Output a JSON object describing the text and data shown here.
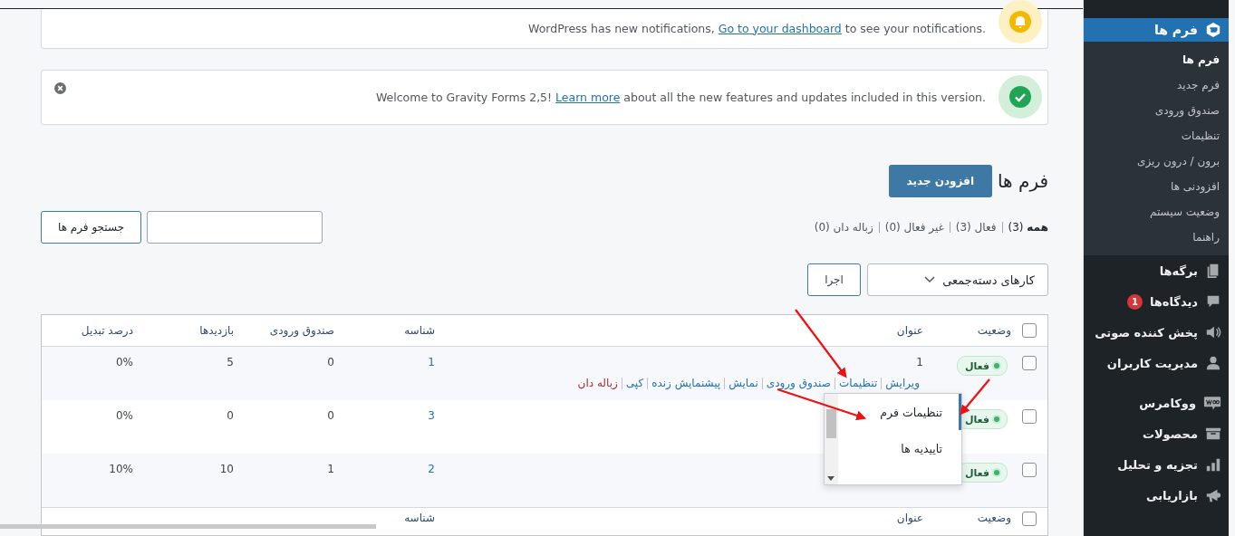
{
  "notices": [
    {
      "kind": "info",
      "before": "WordPress has new notifications, ",
      "link": "Go to your dashboard",
      "after": " to see your notifications.",
      "dismissible": false
    },
    {
      "kind": "success",
      "before": "Welcome to Gravity Forms 2,5! ",
      "link": "Learn more",
      "after": " about all the new features and updates included in this version.",
      "dismissible": true
    }
  ],
  "page_title": "فرم ها",
  "add_button": "افزودن جدید",
  "filters": [
    {
      "label": "همه",
      "count": "(3)",
      "selected": true
    },
    {
      "label": "فعال",
      "count": "(3)",
      "selected": false
    },
    {
      "label": "غیر فعال",
      "count": "(0)",
      "selected": false
    },
    {
      "label": "زباله دان",
      "count": "(0)",
      "selected": false
    }
  ],
  "search": {
    "button": "جستجو فرم ها"
  },
  "bulk_actions": {
    "value": "کارهای دسته‌جمعی",
    "apply": "اجرا"
  },
  "table": {
    "header_checked": false,
    "columns": [
      "وضعیت",
      "عنوان",
      "شناسه",
      "صندوق ورودی",
      "بازدیدها",
      "درصد تبدیل"
    ],
    "rows": [
      {
        "checked": false,
        "status": "فعال",
        "active": true,
        "title": "1",
        "id": "1",
        "entries": "0",
        "views": "5",
        "conversion": "0%",
        "actions": [
          {
            "label": "ویرایش",
            "kind": "link"
          },
          {
            "label": "تنظیمات",
            "kind": "link"
          },
          {
            "label": "صندوق ورودی",
            "kind": "link"
          },
          {
            "label": "نمایش",
            "kind": "link"
          },
          {
            "label": "پیشنمایش زنده",
            "kind": "link"
          },
          {
            "label": "کپی",
            "kind": "link"
          },
          {
            "label": "زباله دان",
            "kind": "danger"
          }
        ]
      },
      {
        "checked": false,
        "status": "فعال",
        "active": true,
        "id": "3",
        "entries": "0",
        "views": "0",
        "conversion": "0%"
      },
      {
        "checked": false,
        "status": "فعال",
        "active": true,
        "id": "2",
        "entries": "1",
        "views": "10",
        "conversion": "10%"
      }
    ],
    "footer_checked": false,
    "footer_columns": [
      "وضعیت",
      "عنوان",
      "شناسه"
    ]
  },
  "dropdown": {
    "items": [
      {
        "label": "تنظیمات فرم",
        "selected": true
      },
      {
        "label": "تاییدیه ها",
        "selected": false
      }
    ]
  },
  "sidebar": {
    "submenu": [
      {
        "label": "فرم ها",
        "selected": true
      },
      {
        "label": "فرم جدید",
        "selected": false
      },
      {
        "label": "صندوق ورودی",
        "selected": false
      },
      {
        "label": "تنظیمات",
        "selected": false
      },
      {
        "label": "برون / درون ریزی",
        "selected": false
      },
      {
        "label": "افزودنی ها",
        "selected": false
      },
      {
        "label": "وضعیت سیستم",
        "selected": false
      },
      {
        "label": "راهنما",
        "selected": false
      }
    ],
    "items": [
      {
        "label": "فرم ها",
        "selected": true
      },
      {
        "label": "برگه‌ها",
        "selected": false
      },
      {
        "label": "دیدگاه‌ها",
        "badge": "1",
        "selected": false
      },
      {
        "label": "پخش کننده صوتی",
        "selected": false
      },
      {
        "label": "مدیریت کاربران",
        "selected": false
      },
      {
        "label": "ووکامرس",
        "selected": false
      },
      {
        "label": "محصولات",
        "selected": false
      },
      {
        "label": "تجزیه و تحلیل",
        "selected": false
      },
      {
        "label": "بازاریابی",
        "selected": false
      }
    ]
  }
}
